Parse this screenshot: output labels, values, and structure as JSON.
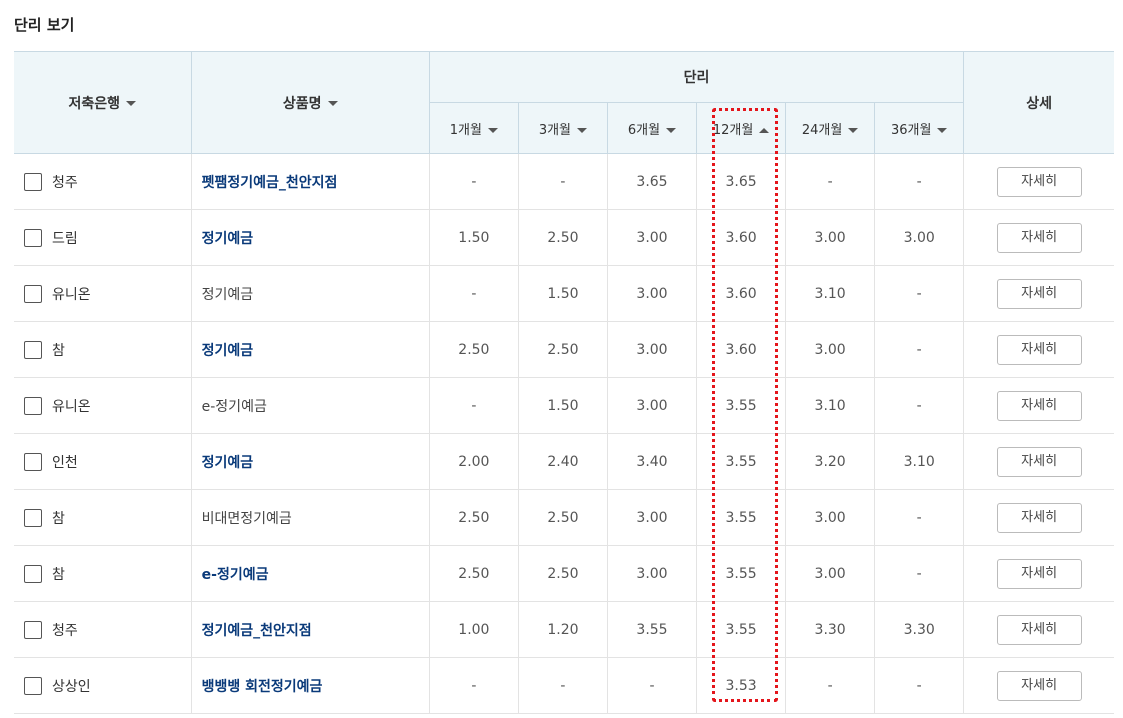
{
  "title": "단리 보기",
  "header": {
    "bank": "저축은행",
    "product": "상품명",
    "rate_group": "단리",
    "detail": "상세",
    "terms": [
      "1개월",
      "3개월",
      "6개월",
      "12개월",
      "24개월",
      "36개월"
    ]
  },
  "sort": {
    "column": "12개월",
    "direction": "descending"
  },
  "rows": [
    {
      "bank": "청주",
      "product": "펫팸정기예금_천안지점",
      "link": true,
      "rates": [
        "-",
        "-",
        "3.65",
        "3.65",
        "-",
        "-"
      ],
      "detail": "자세히"
    },
    {
      "bank": "드림",
      "product": "정기예금",
      "link": true,
      "rates": [
        "1.50",
        "2.50",
        "3.00",
        "3.60",
        "3.00",
        "3.00"
      ],
      "detail": "자세히"
    },
    {
      "bank": "유니온",
      "product": "정기예금",
      "link": false,
      "rates": [
        "-",
        "1.50",
        "3.00",
        "3.60",
        "3.10",
        "-"
      ],
      "detail": "자세히"
    },
    {
      "bank": "참",
      "product": "정기예금",
      "link": true,
      "rates": [
        "2.50",
        "2.50",
        "3.00",
        "3.60",
        "3.00",
        "-"
      ],
      "detail": "자세히"
    },
    {
      "bank": "유니온",
      "product": "e-정기예금",
      "link": false,
      "rates": [
        "-",
        "1.50",
        "3.00",
        "3.55",
        "3.10",
        "-"
      ],
      "detail": "자세히"
    },
    {
      "bank": "인천",
      "product": "정기예금",
      "link": true,
      "rates": [
        "2.00",
        "2.40",
        "3.40",
        "3.55",
        "3.20",
        "3.10"
      ],
      "detail": "자세히"
    },
    {
      "bank": "참",
      "product": "비대면정기예금",
      "link": false,
      "rates": [
        "2.50",
        "2.50",
        "3.00",
        "3.55",
        "3.00",
        "-"
      ],
      "detail": "자세히"
    },
    {
      "bank": "참",
      "product": "e-정기예금",
      "link": true,
      "rates": [
        "2.50",
        "2.50",
        "3.00",
        "3.55",
        "3.00",
        "-"
      ],
      "detail": "자세히"
    },
    {
      "bank": "청주",
      "product": "정기예금_천안지점",
      "link": true,
      "rates": [
        "1.00",
        "1.20",
        "3.55",
        "3.55",
        "3.30",
        "3.30"
      ],
      "detail": "자세히"
    },
    {
      "bank": "상상인",
      "product": "뱅뱅뱅 회전정기예금",
      "link": true,
      "rates": [
        "-",
        "-",
        "-",
        "3.53",
        "-",
        "-"
      ],
      "detail": "자세히"
    }
  ],
  "colors": {
    "header_bg": "#eef6f9",
    "link": "#0a3a7a",
    "highlight": "#e4151b"
  }
}
